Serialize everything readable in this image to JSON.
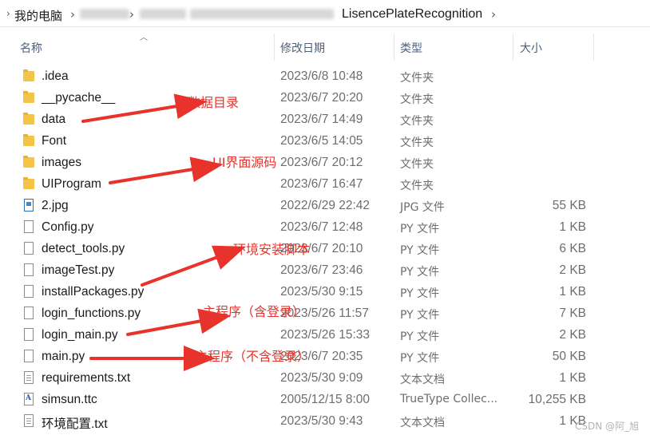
{
  "address_bar": {
    "root": "我的电脑",
    "current_folder": "LisencePlateRecognition",
    "sep_glyph": "›"
  },
  "columns": {
    "name": "名称",
    "date": "修改日期",
    "type": "类型",
    "size": "大小"
  },
  "rows": [
    {
      "name": ".idea",
      "date": "2023/6/8 10:48",
      "type": "文件夹",
      "size": "",
      "icon": "folder-icon"
    },
    {
      "name": "__pycache__",
      "date": "2023/6/7 20:20",
      "type": "文件夹",
      "size": "",
      "icon": "folder-icon"
    },
    {
      "name": "data",
      "date": "2023/6/7 14:49",
      "type": "文件夹",
      "size": "",
      "icon": "folder-icon"
    },
    {
      "name": "Font",
      "date": "2023/6/5 14:05",
      "type": "文件夹",
      "size": "",
      "icon": "folder-icon"
    },
    {
      "name": "images",
      "date": "2023/6/7 20:12",
      "type": "文件夹",
      "size": "",
      "icon": "folder-icon"
    },
    {
      "name": "UIProgram",
      "date": "2023/6/7 16:47",
      "type": "文件夹",
      "size": "",
      "icon": "folder-icon"
    },
    {
      "name": "2.jpg",
      "date": "2022/6/29 22:42",
      "type": "JPG 文件",
      "size": "55 KB",
      "icon": "image-file-icon"
    },
    {
      "name": "Config.py",
      "date": "2023/6/7 12:48",
      "type": "PY 文件",
      "size": "1 KB",
      "icon": "file-icon"
    },
    {
      "name": "detect_tools.py",
      "date": "2023/6/7 20:10",
      "type": "PY 文件",
      "size": "6 KB",
      "icon": "file-icon"
    },
    {
      "name": "imageTest.py",
      "date": "2023/6/7 23:46",
      "type": "PY 文件",
      "size": "2 KB",
      "icon": "file-icon"
    },
    {
      "name": "installPackages.py",
      "date": "2023/5/30 9:15",
      "type": "PY 文件",
      "size": "1 KB",
      "icon": "file-icon"
    },
    {
      "name": "login_functions.py",
      "date": "2023/5/26 11:57",
      "type": "PY 文件",
      "size": "7 KB",
      "icon": "file-icon"
    },
    {
      "name": "login_main.py",
      "date": "2023/5/26 15:33",
      "type": "PY 文件",
      "size": "2 KB",
      "icon": "file-icon"
    },
    {
      "name": "main.py",
      "date": "2023/6/7 20:35",
      "type": "PY 文件",
      "size": "50 KB",
      "icon": "file-icon"
    },
    {
      "name": "requirements.txt",
      "date": "2023/5/30 9:09",
      "type": "文本文档",
      "size": "1 KB",
      "icon": "text-file-icon"
    },
    {
      "name": "simsun.ttc",
      "date": "2005/12/15 8:00",
      "type": "TrueType Collec...",
      "size": "10,255 KB",
      "icon": "font-file-icon"
    },
    {
      "name": "环境配置.txt",
      "date": "2023/5/30 9:43",
      "type": "文本文档",
      "size": "1 KB",
      "icon": "text-file-icon"
    }
  ],
  "annotations": {
    "data_dir": "数据目录",
    "ui_source": "UI界面源码",
    "env_script": "环境安装脚本",
    "main_with_login": "主程序（含登录）",
    "main_without_login": "主程序（不含登录）",
    "color": "#e8332c"
  },
  "watermark": "CSDN @阿_旭"
}
